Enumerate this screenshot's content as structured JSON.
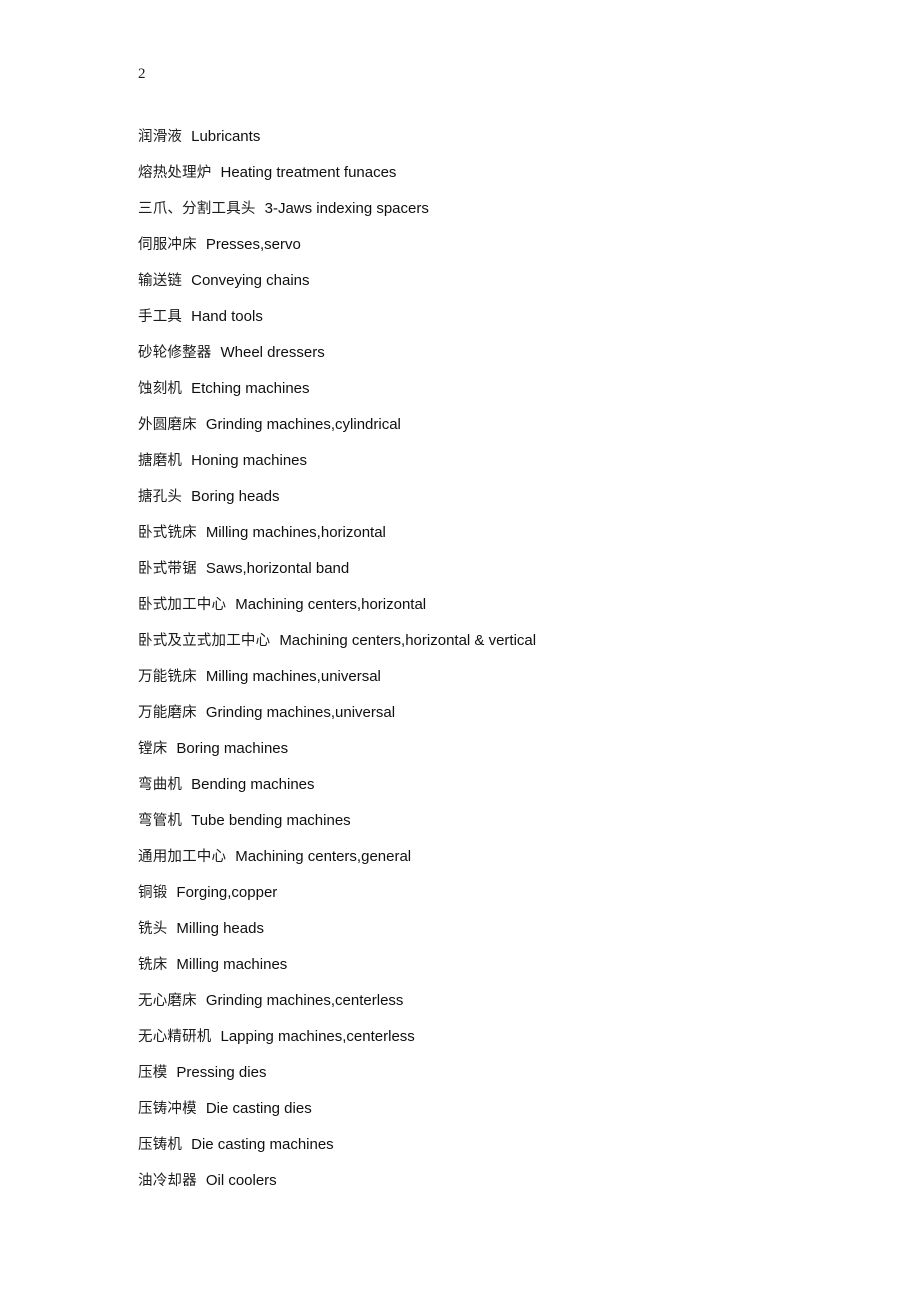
{
  "document": {
    "page_number": "2",
    "glossary": [
      {
        "zh": "润滑液",
        "en": "Lubricants"
      },
      {
        "zh": "熔热处理炉",
        "en": "Heating   treatment   funaces"
      },
      {
        "zh": "三爪、分割工具头",
        "en": "3-Jaws   indexing   spacers"
      },
      {
        "zh": "伺服冲床",
        "en": "Presses,servo"
      },
      {
        "zh": "输送链",
        "en": "Conveying   chains"
      },
      {
        "zh": "手工具",
        "en": "Hand   tools"
      },
      {
        "zh": "砂轮修整器",
        "en": "Wheel   dressers"
      },
      {
        "zh": "蚀刻机",
        "en": "Etching   machines"
      },
      {
        "zh": "外圆磨床",
        "en": "Grinding   machines,cylindrical"
      },
      {
        "zh": "搪磨机",
        "en": "Honing   machines"
      },
      {
        "zh": "搪孔头",
        "en": "Boring   heads"
      },
      {
        "zh": "卧式铣床",
        "en": "Milling   machines,horizontal"
      },
      {
        "zh": "卧式带锯",
        "en": "Saws,horizontal   band"
      },
      {
        "zh": "卧式加工中心",
        "en": "Machining   centers,horizontal"
      },
      {
        "zh": "卧式及立式加工中心",
        "en": "Machining   centers,horizontal   &   vertical"
      },
      {
        "zh": "万能铣床",
        "en": "Milling   machines,universal"
      },
      {
        "zh": "万能磨床",
        "en": "Grinding   machines,universal"
      },
      {
        "zh": "镗床",
        "en": "Boring   machines"
      },
      {
        "zh": "弯曲机",
        "en": "Bending   machines"
      },
      {
        "zh": "弯管机",
        "en": "Tube   bending   machines"
      },
      {
        "zh": "通用加工中心",
        "en": "Machining   centers,general"
      },
      {
        "zh": "铜锻",
        "en": "Forging,copper"
      },
      {
        "zh": "铣头",
        "en": "Milling   heads"
      },
      {
        "zh": "铣床",
        "en": "Milling   machines"
      },
      {
        "zh": "无心磨床",
        "en": "Grinding   machines,centerless"
      },
      {
        "zh": "无心精研机",
        "en": "Lapping   machines,centerless"
      },
      {
        "zh": "压模",
        "en": "Pressing   dies"
      },
      {
        "zh": "压铸冲模",
        "en": "Die   casting   dies"
      },
      {
        "zh": "压铸机",
        "en": "Die   casting   machines"
      },
      {
        "zh": "油冷却器",
        "en": "Oil   coolers"
      }
    ]
  }
}
